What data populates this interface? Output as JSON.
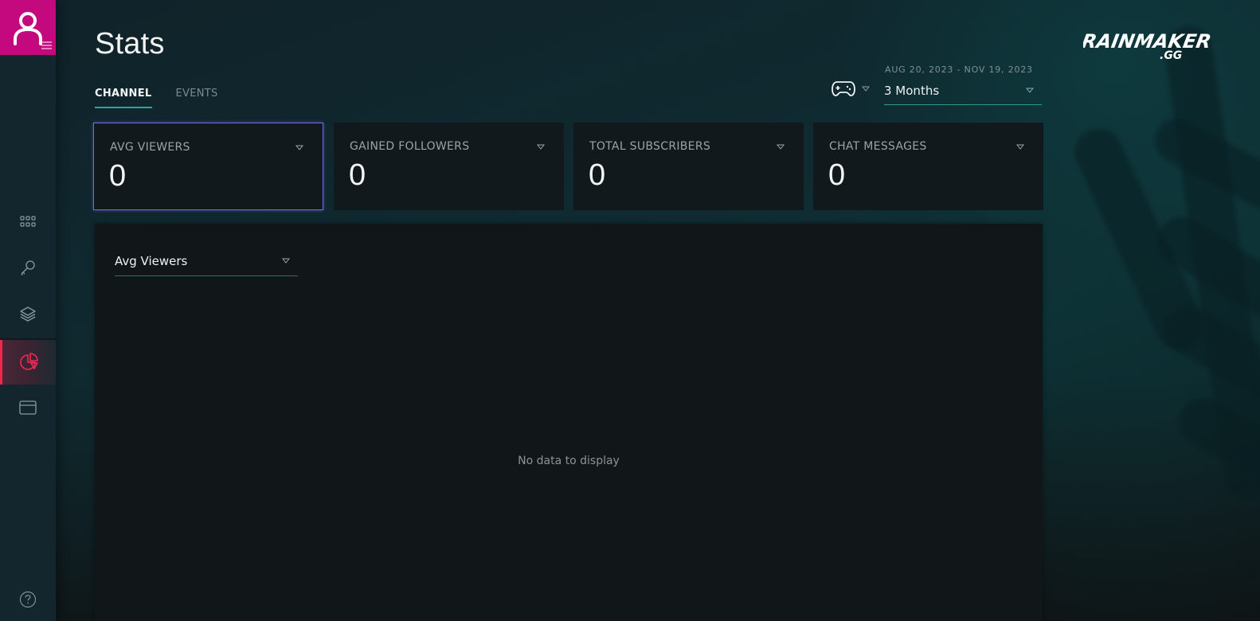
{
  "page": {
    "title": "Stats",
    "tabs": [
      {
        "label": "CHANNEL",
        "active": true
      },
      {
        "label": "EVENTS",
        "active": false
      }
    ]
  },
  "sidebar": {
    "avatar_icon": "user-icon",
    "menu_icon": "hamburger-icon",
    "items": [
      {
        "icon": "grid-icon",
        "label": "Dashboard",
        "active": false
      },
      {
        "icon": "key-icon",
        "label": "Keys",
        "active": false
      },
      {
        "icon": "layers-icon",
        "label": "Layers",
        "active": false
      },
      {
        "icon": "pie-chart-icon",
        "label": "Stats",
        "active": true
      },
      {
        "icon": "card-icon",
        "label": "Billing",
        "active": false
      }
    ],
    "help_icon": "help-icon",
    "active_color": "#f0264c",
    "avatar_color": "#c4087e"
  },
  "header": {
    "game_icon": "gamepad-icon",
    "date_range": "AUG 20, 2023 - NOV 19, 2023",
    "period": "3 Months",
    "logo_text": "RAINMAKER",
    "logo_sub": ".GG"
  },
  "stats": [
    {
      "label": "AVG VIEWERS",
      "value": "0",
      "selected": true
    },
    {
      "label": "GAINED FOLLOWERS",
      "value": "0",
      "selected": false
    },
    {
      "label": "TOTAL SUBSCRIBERS",
      "value": "0",
      "selected": false
    },
    {
      "label": "CHAT MESSAGES",
      "value": "0",
      "selected": false
    }
  ],
  "chart": {
    "metric": "Avg Viewers",
    "empty_message": "No data to display"
  },
  "colors": {
    "accent_teal": "#2aa79d",
    "selected_border": "#7168e8"
  }
}
